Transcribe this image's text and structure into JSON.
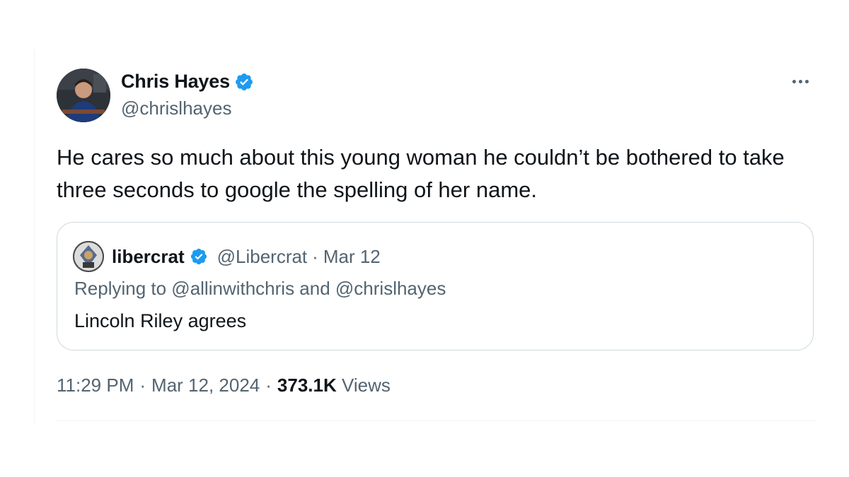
{
  "tweet": {
    "display_name": "Chris Hayes",
    "handle": "@chrislhayes",
    "text": "He cares so much about this young woman he couldn’t be bothered to take three seconds to google the spelling of her name.",
    "time": "11:29 PM",
    "date": "Mar 12, 2024",
    "views_count": "373.1K",
    "views_label": "Views",
    "separator": "·"
  },
  "quote": {
    "display_name": "libercrat",
    "handle": "@Libercrat",
    "separator": "·",
    "date": "Mar 12",
    "replying": "Replying to @allinwithchris and @chrislhayes",
    "text": "Lincoln Riley agrees"
  },
  "icons": {
    "verified": "verified-badge-icon",
    "more": "more-horizontal-icon"
  },
  "colors": {
    "verified_blue": "#1d9bf0",
    "secondary_text": "#536471",
    "border": "#cfd9de"
  }
}
